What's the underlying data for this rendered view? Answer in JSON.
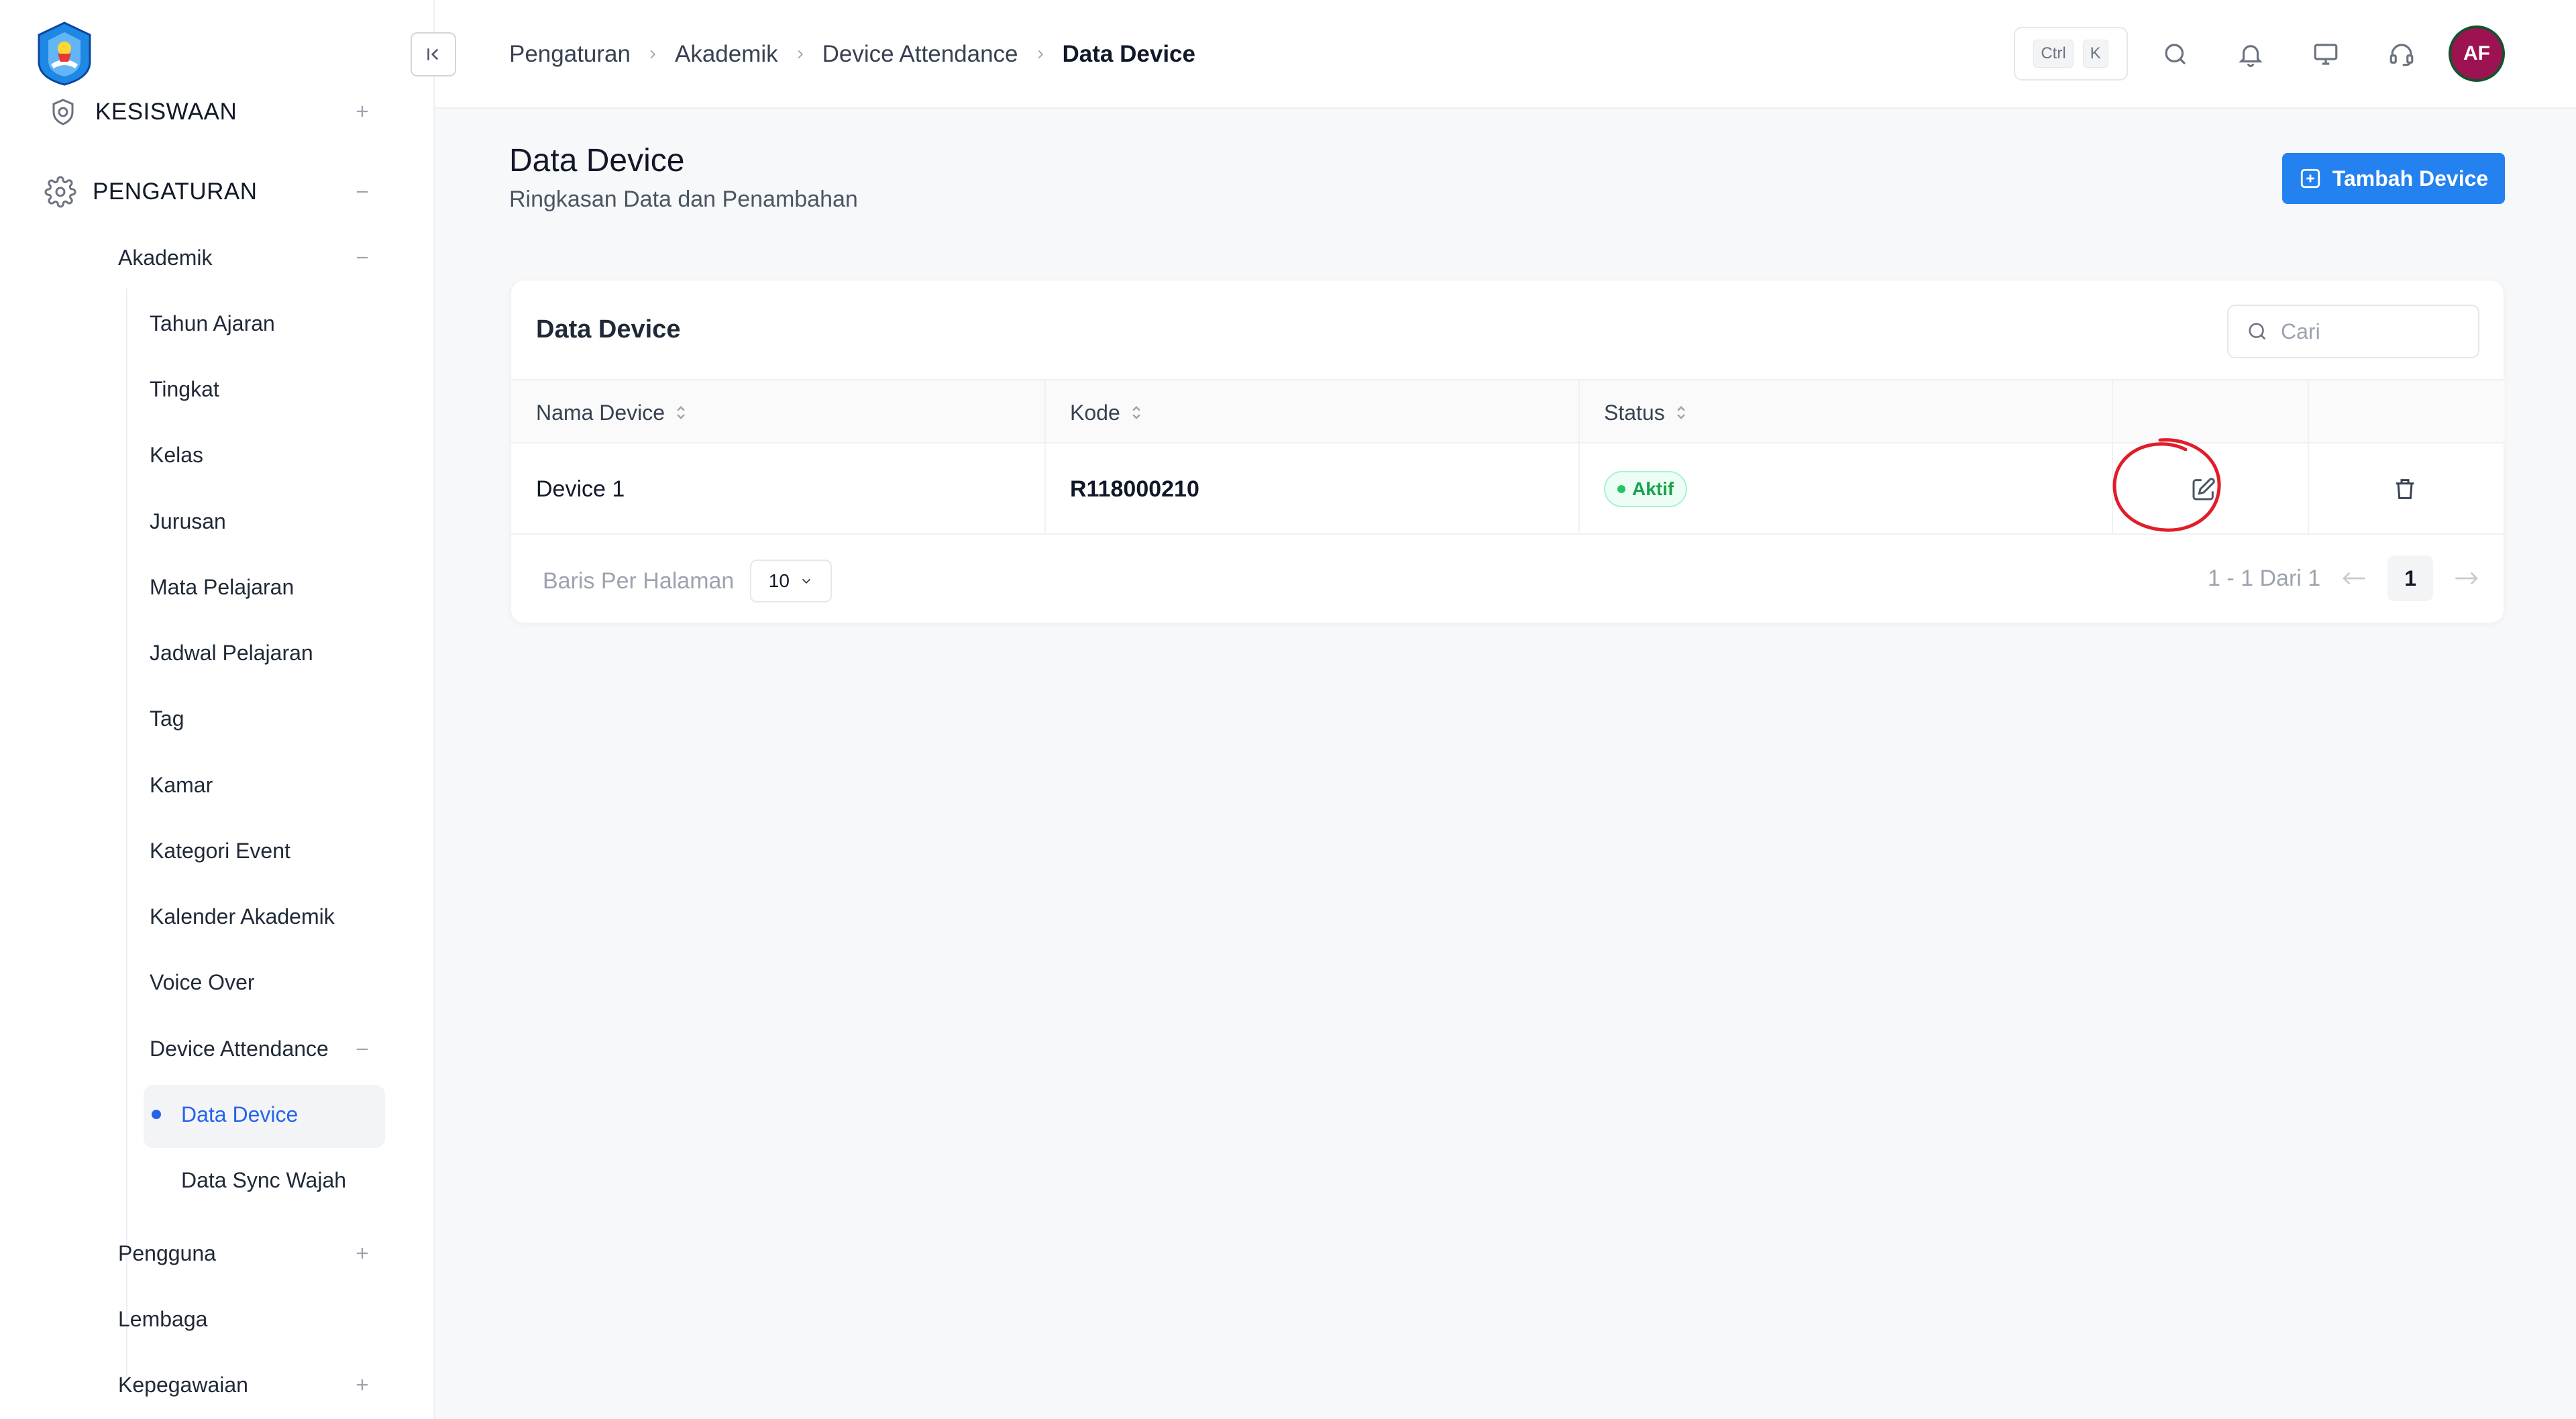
{
  "colors": {
    "accent": "#2381f0",
    "active_text": "#2563eb",
    "success": "#16a34a",
    "avatar_bg": "#9d1250",
    "annotation": "#e11d2a"
  },
  "sidebar": {
    "sections": [
      {
        "label": "KESISWAAN",
        "icon": "shield-gear-icon",
        "toggle": "+"
      },
      {
        "label": "PENGATURAN",
        "icon": "gear-icon",
        "toggle": "−"
      }
    ],
    "akademik": {
      "label": "Akademik",
      "toggle": "−"
    },
    "items": [
      "Tahun Ajaran",
      "Tingkat",
      "Kelas",
      "Jurusan",
      "Mata Pelajaran",
      "Jadwal Pelajaran",
      "Tag",
      "Kamar",
      "Kategori Event",
      "Kalender Akademik",
      "Voice Over"
    ],
    "device_attendance": {
      "label": "Device Attendance",
      "toggle": "−"
    },
    "sub_items": [
      {
        "label": "Data Device",
        "active": true
      },
      {
        "label": "Data Sync Wajah",
        "active": false
      }
    ],
    "bottom": [
      {
        "label": "Pengguna",
        "toggle": "+"
      },
      {
        "label": "Lembaga",
        "toggle": ""
      },
      {
        "label": "Kepegawaian",
        "toggle": "+"
      }
    ]
  },
  "topbar": {
    "breadcrumb": [
      "Pengaturan",
      "Akademik",
      "Device Attendance"
    ],
    "breadcrumb_current": "Data Device",
    "kbd": [
      "Ctrl",
      "K"
    ],
    "avatar_initials": "AF"
  },
  "page": {
    "title": "Data Device",
    "subtitle": "Ringkasan Data dan Penambahan",
    "add_button": "Tambah Device"
  },
  "card": {
    "title": "Data Device",
    "search_placeholder": "Cari",
    "columns": [
      "Nama Device",
      "Kode",
      "Status"
    ],
    "rows": [
      {
        "name": "Device 1",
        "code": "R118000210",
        "status": "Aktif"
      }
    ],
    "pagination": {
      "per_page_label": "Baris Per Halaman",
      "per_page_value": "10",
      "range": "1 - 1 Dari 1",
      "current_page": "1"
    }
  }
}
